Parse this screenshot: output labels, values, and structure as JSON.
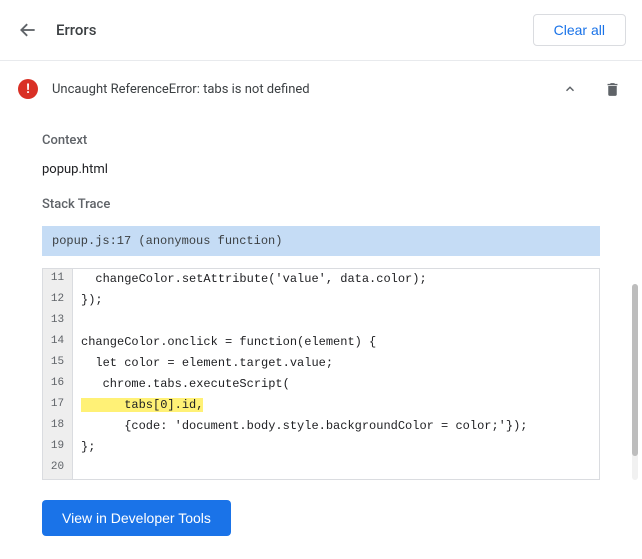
{
  "header": {
    "title": "Errors",
    "clear_all_label": "Clear all"
  },
  "error": {
    "title": "Uncaught ReferenceError: tabs is not defined",
    "context_label": "Context",
    "context_value": "popup.html",
    "stack_trace_label": "Stack Trace",
    "stack_trace_value": "popup.js:17 (anonymous function)",
    "code_lines": [
      {
        "num": "11",
        "text": "  changeColor.setAttribute('value', data.color);",
        "highlighted": false
      },
      {
        "num": "12",
        "text": "});",
        "highlighted": false
      },
      {
        "num": "13",
        "text": "",
        "highlighted": false
      },
      {
        "num": "14",
        "text": "changeColor.onclick = function(element) {",
        "highlighted": false
      },
      {
        "num": "15",
        "text": "  let color = element.target.value;",
        "highlighted": false
      },
      {
        "num": "16",
        "text": "   chrome.tabs.executeScript(",
        "highlighted": false
      },
      {
        "num": "17",
        "text": "      tabs[0].id,",
        "highlighted": true
      },
      {
        "num": "18",
        "text": "      {code: 'document.body.style.backgroundColor = color;'});",
        "highlighted": false
      },
      {
        "num": "19",
        "text": "};",
        "highlighted": false
      },
      {
        "num": "20",
        "text": "",
        "highlighted": false
      }
    ]
  },
  "footer": {
    "view_devtools_label": "View in Developer Tools"
  }
}
